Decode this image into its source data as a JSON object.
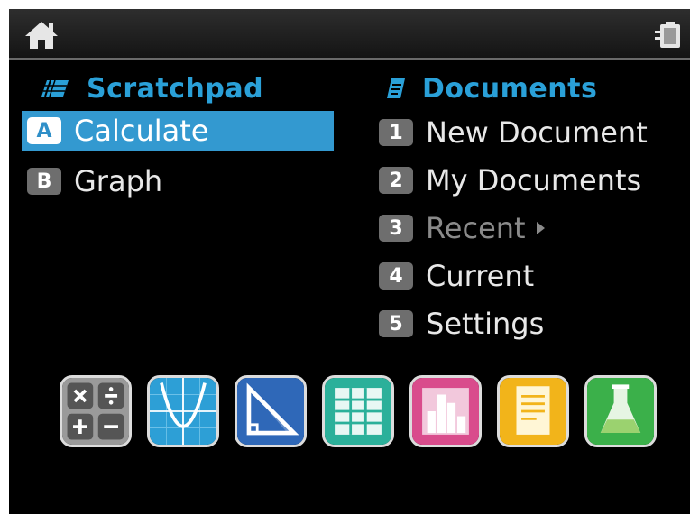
{
  "topbar": {
    "home_icon": "home-icon",
    "battery_icon": "battery-icon"
  },
  "scratchpad": {
    "title": "Scratchpad",
    "icon": "scratchpad-icon",
    "items": [
      {
        "key": "A",
        "label": "Calculate",
        "selected": true
      },
      {
        "key": "B",
        "label": "Graph",
        "selected": false
      }
    ]
  },
  "documents": {
    "title": "Documents",
    "icon": "documents-icon",
    "items": [
      {
        "key": "1",
        "label": "New Document"
      },
      {
        "key": "2",
        "label": "My Documents"
      },
      {
        "key": "3",
        "label": "Recent",
        "disabled": true,
        "has_submenu": true
      },
      {
        "key": "4",
        "label": "Current"
      },
      {
        "key": "5",
        "label": "Settings"
      }
    ]
  },
  "app_icons": [
    "calculator-app-icon",
    "graphs-app-icon",
    "geometry-app-icon",
    "lists-spreadsheet-app-icon",
    "data-statistics-app-icon",
    "notes-app-icon",
    "vernier-dataquest-app-icon"
  ],
  "colors": {
    "accent": "#2aa0d8",
    "selection": "#3399d0",
    "background": "#000000",
    "disabled_text": "#8a8a8a"
  }
}
